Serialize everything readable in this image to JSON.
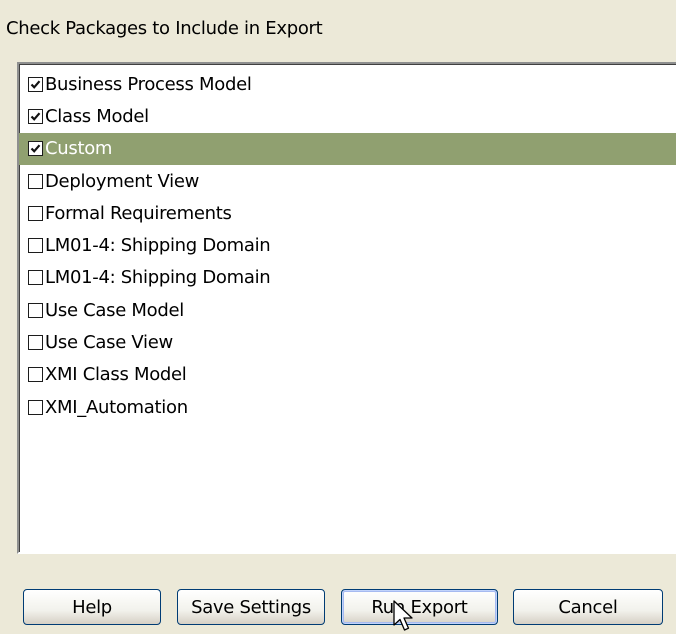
{
  "dialog": {
    "heading": "Check Packages to Include in Export"
  },
  "packages": [
    {
      "label": "Business Process Model",
      "checked": true,
      "selected": false
    },
    {
      "label": "Class Model",
      "checked": true,
      "selected": false
    },
    {
      "label": "Custom",
      "checked": true,
      "selected": true
    },
    {
      "label": "Deployment View",
      "checked": false,
      "selected": false
    },
    {
      "label": "Formal Requirements",
      "checked": false,
      "selected": false
    },
    {
      "label": "LM01-4: Shipping Domain",
      "checked": false,
      "selected": false
    },
    {
      "label": "LM01-4: Shipping Domain",
      "checked": false,
      "selected": false
    },
    {
      "label": "Use Case Model",
      "checked": false,
      "selected": false
    },
    {
      "label": "Use Case View",
      "checked": false,
      "selected": false
    },
    {
      "label": "XMI Class Model",
      "checked": false,
      "selected": false
    },
    {
      "label": "XMI_Automation",
      "checked": false,
      "selected": false
    }
  ],
  "buttons": {
    "help": "Help",
    "save_settings": "Save Settings",
    "run_export": "Run Export",
    "cancel": "Cancel"
  },
  "colors": {
    "selection_background": "#90A070",
    "dialog_background": "#ECE9D8"
  },
  "icons": {
    "checkbox_mark": "checkmark-icon",
    "pointer": "mouse-pointer-icon"
  }
}
